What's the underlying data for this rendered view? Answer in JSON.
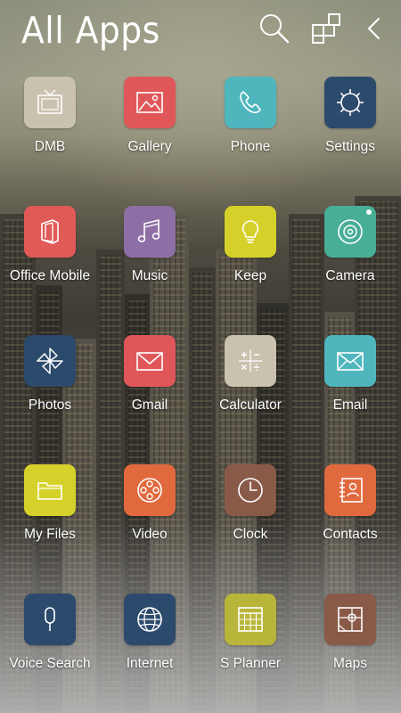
{
  "header": {
    "title": "All Apps",
    "search_icon": "search-icon",
    "grid_icon": "app-grid-icon",
    "back_icon": "chevron-left-icon"
  },
  "apps": [
    {
      "label": "DMB",
      "icon": "tv-icon",
      "color": "#c9c2ae"
    },
    {
      "label": "Gallery",
      "icon": "image-icon",
      "color": "#e0575a"
    },
    {
      "label": "Phone",
      "icon": "phone-icon",
      "color": "#4fb6be"
    },
    {
      "label": "Settings",
      "icon": "settings-gear-icon",
      "color": "#2c4a6c"
    },
    {
      "label": "Office Mobile",
      "icon": "office-icon",
      "color": "#e05a57"
    },
    {
      "label": "Music",
      "icon": "music-note-icon",
      "color": "#8d6fa5"
    },
    {
      "label": "Keep",
      "icon": "lightbulb-icon",
      "color": "#d6d12a"
    },
    {
      "label": "Camera",
      "icon": "camera-lens-icon",
      "color": "#48ae96"
    },
    {
      "label": "Photos",
      "icon": "pinwheel-icon",
      "color": "#2c4a6c"
    },
    {
      "label": "Gmail",
      "icon": "mail-envelope-icon",
      "color": "#e0575a"
    },
    {
      "label": "Calculator",
      "icon": "calculator-icon",
      "color": "#c9c2ae"
    },
    {
      "label": "Email",
      "icon": "envelope-icon",
      "color": "#4fb6be"
    },
    {
      "label": "My Files",
      "icon": "folder-icon",
      "color": "#d6d12a"
    },
    {
      "label": "Video",
      "icon": "film-reel-icon",
      "color": "#e0693e"
    },
    {
      "label": "Clock",
      "icon": "clock-icon",
      "color": "#8a5a48"
    },
    {
      "label": "Contacts",
      "icon": "contacts-book-icon",
      "color": "#e0693e"
    },
    {
      "label": "Voice Search",
      "icon": "microphone-icon",
      "color": "#2c4a6c"
    },
    {
      "label": "Internet",
      "icon": "globe-icon",
      "color": "#2c4a6c"
    },
    {
      "label": "S Planner",
      "icon": "calendar-icon",
      "color": "#b9b53a"
    },
    {
      "label": "Maps",
      "icon": "map-icon",
      "color": "#8a5a48"
    }
  ]
}
